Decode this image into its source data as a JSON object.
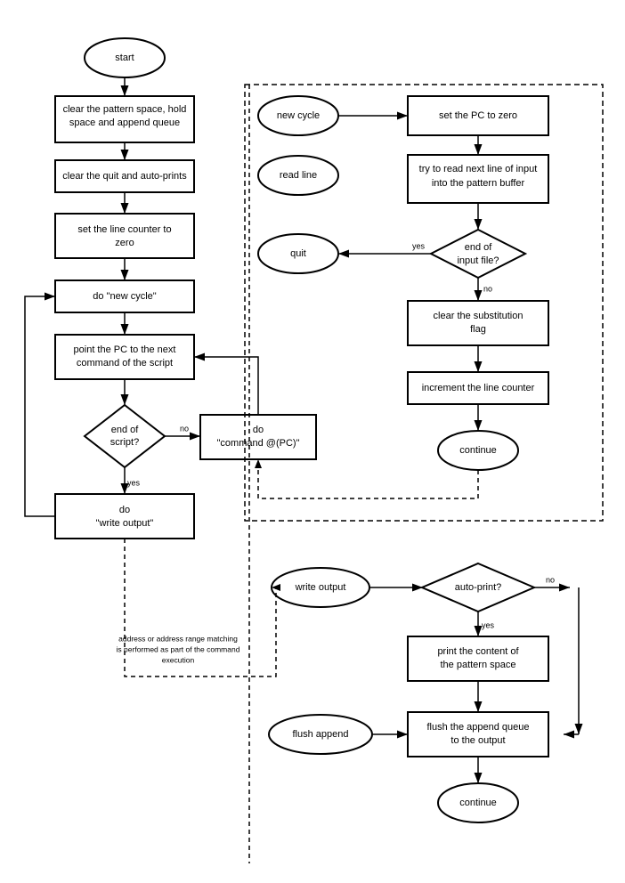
{
  "nodes": {
    "start": {
      "label": "start"
    },
    "clear_pattern": {
      "label": "clear the pattern space, hold\nspace and append queue"
    },
    "clear_quit": {
      "label": "clear the quit and auto-prints"
    },
    "set_line_counter": {
      "label": "set the line counter to\nzero"
    },
    "do_new_cycle": {
      "label": "do \"new cycle\""
    },
    "point_pc": {
      "label": "point the PC to the next\ncommand of the script"
    },
    "end_of_script": {
      "label": "end of\nscript?"
    },
    "do_command": {
      "label": "do\n\"command @(PC)\""
    },
    "do_write_output": {
      "label": "do\n\"write output\""
    },
    "new_cycle": {
      "label": "new cycle"
    },
    "read_line": {
      "label": "read line"
    },
    "quit": {
      "label": "quit"
    },
    "set_pc_zero": {
      "label": "set the PC to zero"
    },
    "try_read": {
      "label": "try to read next line of input\ninto the pattern buffer"
    },
    "end_of_input": {
      "label": "end of\ninput file?"
    },
    "clear_sub": {
      "label": "clear the substitution\nflag"
    },
    "increment_line": {
      "label": "increment the line counter"
    },
    "continue1": {
      "label": "continue"
    },
    "write_output": {
      "label": "write output"
    },
    "auto_print": {
      "label": "auto-print?"
    },
    "print_pattern": {
      "label": "print the content of\nthe pattern space"
    },
    "flush_append": {
      "label": "flush append"
    },
    "flush_queue": {
      "label": "flush the append queue\nto the output"
    },
    "continue2": {
      "label": "continue"
    },
    "address_note": {
      "label": "address or address range matching\nis performed as part of the command\nexecution"
    }
  },
  "labels": {
    "yes": "yes",
    "no": "no"
  }
}
